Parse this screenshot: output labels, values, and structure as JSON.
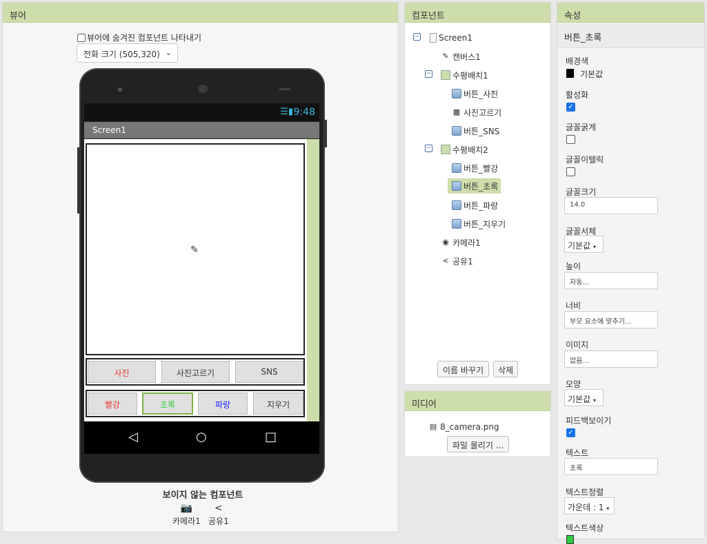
{
  "viewer": {
    "title": "뷰어",
    "show_hidden_label": "뷰어에 숨겨진 컴포넌트 나타내기",
    "screen_size": "전화 크기 (505,320)",
    "phone": {
      "time": "9:48",
      "screen_title": "Screen1",
      "row1": [
        "사진",
        "사진고르기",
        "SNS"
      ],
      "row2": [
        "빨강",
        "초록",
        "파랑",
        "지우기"
      ],
      "row1_colors": [
        "#e53935",
        "#333333",
        "#333333"
      ],
      "row2_colors": [
        "#e53935",
        "#2ecc40",
        "#1a1aff",
        "#333333"
      ]
    },
    "invisible_title": "보이지 않는 컴포넌트",
    "invisible": [
      "카메라1",
      "공유1"
    ]
  },
  "components": {
    "title": "컴포넌트",
    "tree": [
      {
        "label": "Screen1",
        "icon": "screen-icon"
      },
      {
        "label": "캔버스1",
        "icon": "canvas-icon"
      },
      {
        "label": "수평배치1",
        "icon": "horizontal-arrangement-icon"
      },
      {
        "label": "버튼_사진",
        "icon": "button-icon"
      },
      {
        "label": "사진고르기",
        "icon": "image-picker-icon"
      },
      {
        "label": "버튼_SNS",
        "icon": "button-icon"
      },
      {
        "label": "수평배치2",
        "icon": "horizontal-arrangement-icon"
      },
      {
        "label": "버튼_빨강",
        "icon": "button-icon"
      },
      {
        "label": "버튼_초록",
        "icon": "button-icon"
      },
      {
        "label": "버튼_파랑",
        "icon": "button-icon"
      },
      {
        "label": "버튼_지우기",
        "icon": "button-icon"
      },
      {
        "label": "카메라1",
        "icon": "camera-icon"
      },
      {
        "label": "공유1",
        "icon": "share-icon"
      }
    ],
    "selected": "버튼_초록",
    "rename_button": "이름 바꾸기",
    "delete_button": "삭제"
  },
  "media": {
    "title": "미디어",
    "file": "8_camera.png",
    "upload_button": "파일 올리기 ..."
  },
  "properties": {
    "title": "속성",
    "component": "버튼_초록",
    "bg_color_label": "배경색",
    "bg_color_value": "기본값",
    "enabled_label": "활성화",
    "enabled": true,
    "bold_label": "글꼴굵게",
    "bold": false,
    "italic_label": "글꼴이텔릭",
    "italic": false,
    "font_size_label": "글꼴크기",
    "font_size": "14.0",
    "typeface_label": "글꼴서체",
    "typeface": "기본값",
    "height_label": "높이",
    "height": "자동...",
    "width_label": "너비",
    "width": "부모 요소에 맞추기...",
    "image_label": "이미지",
    "image": "없음...",
    "shape_label": "모양",
    "shape": "기본값",
    "feedback_label": "피드백보이기",
    "feedback": true,
    "text_label": "텍스트",
    "text": "초록",
    "text_align_label": "텍스트정렬",
    "text_align": "가운데 : 1",
    "text_color_label": "텍스트색상",
    "text_color": "#2ecc40"
  }
}
